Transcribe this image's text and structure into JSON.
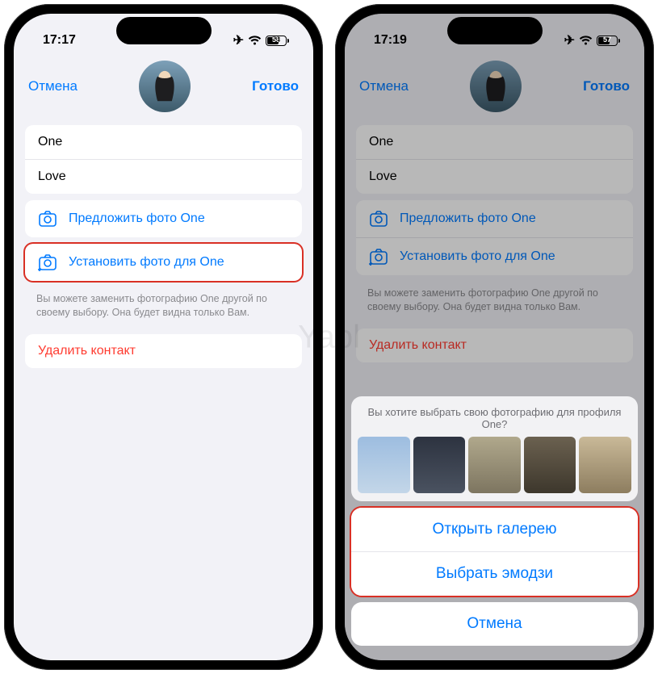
{
  "watermark": "Yabl",
  "left": {
    "time": "17:17",
    "battery": "58",
    "nav": {
      "cancel": "Отмена",
      "done": "Готово"
    },
    "name_first": "One",
    "name_last": "Love",
    "suggest_photo": "Предложить фото One",
    "set_photo": "Установить фото для One",
    "hint": "Вы можете заменить фотографию One другой по своему выбору. Она будет видна только Вам.",
    "delete": "Удалить контакт"
  },
  "right": {
    "time": "17:19",
    "battery": "57",
    "nav": {
      "cancel": "Отмена",
      "done": "Готово"
    },
    "name_first": "One",
    "name_last": "Love",
    "suggest_photo": "Предложить фото One",
    "set_photo": "Установить фото для One",
    "hint": "Вы можете заменить фотографию One другой по своему выбору. Она будет видна только Вам.",
    "delete": "Удалить контакт",
    "sheet": {
      "title": "Вы хотите выбрать свою фотографию для профиля One?",
      "open_gallery": "Открыть галерею",
      "pick_emoji": "Выбрать эмодзи",
      "cancel": "Отмена"
    }
  }
}
